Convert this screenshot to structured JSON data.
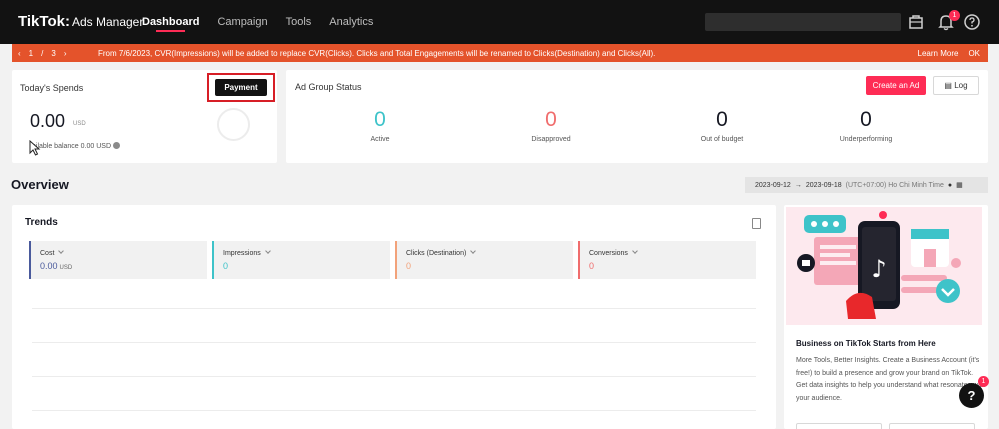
{
  "header": {
    "brand": "TikTok",
    "brand_sub": "Ads Manager",
    "nav": [
      "Dashboard",
      "Campaign",
      "Tools",
      "Analytics"
    ],
    "notification_count": "1"
  },
  "announcement": {
    "pager": {
      "prev": "‹",
      "current": "1",
      "sep": "/",
      "total": "3",
      "next": "›"
    },
    "message": "From 7/6/2023, CVR(Impressions) will be added to replace CVR(Clicks). Clicks and Total Engagements will be renamed to Clicks(Destination) and Clicks(All).",
    "learn_more": "Learn More",
    "ok": "OK"
  },
  "spends": {
    "title": "Today's Spends",
    "payment_label": "Payment",
    "amount": "0.00",
    "currency": "USD",
    "balance_label": "ailable balance 0.00 USD"
  },
  "ad_group": {
    "title": "Ad Group Status",
    "create_label": "Create an Ad",
    "log_label": "Log",
    "statuses": [
      {
        "value": "0",
        "label": "Active"
      },
      {
        "value": "0",
        "label": "Disapproved"
      },
      {
        "value": "0",
        "label": "Out of budget"
      },
      {
        "value": "0",
        "label": "Underperforming"
      }
    ]
  },
  "overview": {
    "title": "Overview",
    "date_start": "2023-09-12",
    "arrow": "→",
    "date_end": "2023-09-18",
    "timezone": "(UTC+07:00) Ho Chi Minh Time"
  },
  "trends": {
    "title": "Trends",
    "metrics": [
      {
        "name": "Cost",
        "value": "0.00",
        "unit": "USD",
        "color": "#4a5a9c"
      },
      {
        "name": "Impressions",
        "value": "0",
        "unit": "",
        "color": "#3ec3c9"
      },
      {
        "name": "Clicks (Destination)",
        "value": "0",
        "unit": "",
        "color": "#f2a27a"
      },
      {
        "name": "Conversions",
        "value": "0",
        "unit": "",
        "color": "#f06d6d"
      }
    ]
  },
  "promo": {
    "title": "Business on TikTok Starts from Here",
    "description": "More Tools, Better Insights. Create a Business Account (it's free!) to build a presence and grow your brand on TikTok. Get data insights to help you understand what resonates with your audience."
  },
  "help_badge": "1",
  "colors": {
    "brand_pink": "#fe2c55",
    "announcement_orange": "#e4532b",
    "highlight_red": "#d71e26",
    "topbar": "#121212"
  }
}
